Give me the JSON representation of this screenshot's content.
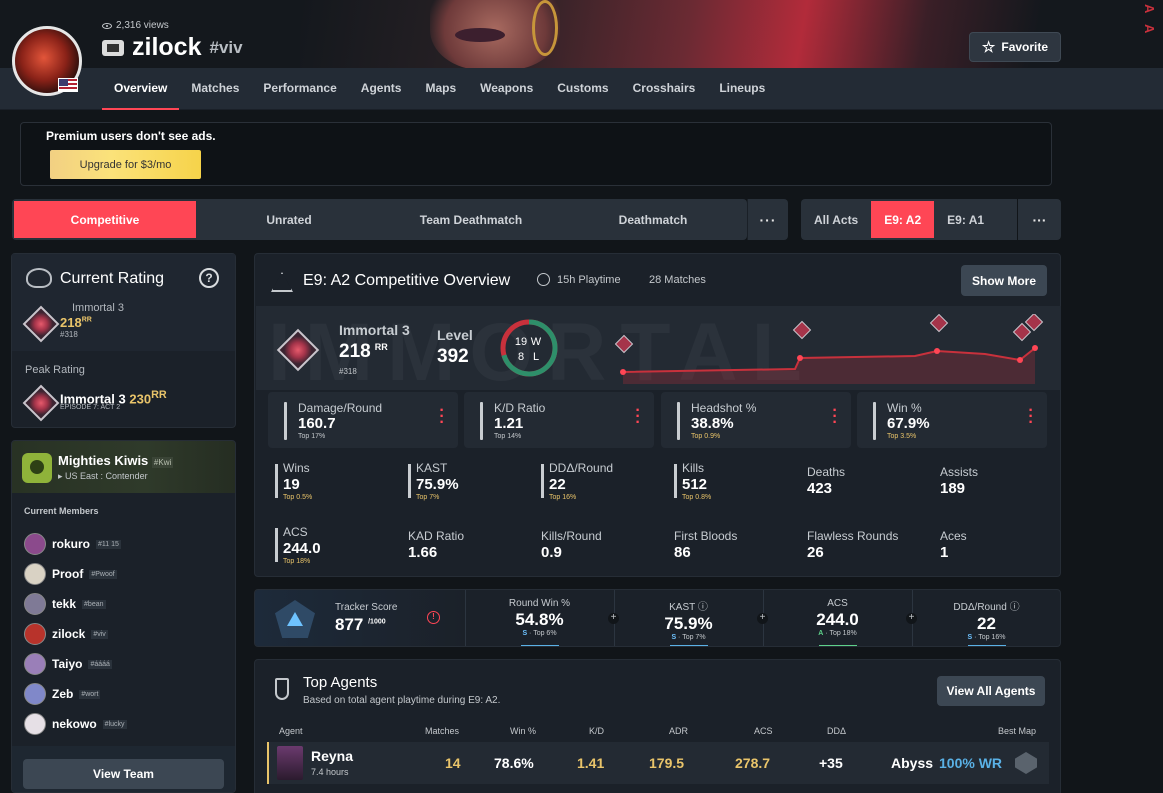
{
  "profile": {
    "views": "2,316 views",
    "username": "zilock",
    "tagline": "#viv",
    "favorite_label": "Favorite",
    "hero_text": "A A"
  },
  "nav_tabs": [
    "Overview",
    "Matches",
    "Performance",
    "Agents",
    "Maps",
    "Weapons",
    "Customs",
    "Crosshairs",
    "Lineups"
  ],
  "ad": {
    "text": "Premium users don't see ads.",
    "button": "Upgrade for $3/mo"
  },
  "modes": [
    "Competitive",
    "Unrated",
    "Team Deathmatch",
    "Deathmatch"
  ],
  "more_label": "···",
  "acts": [
    "All Acts",
    "E9: A2",
    "E9: A1"
  ],
  "current_rating": {
    "title": "Current Rating",
    "help": "?",
    "rank": "Immortal 3",
    "rr": "218",
    "rr_unit": "RR",
    "position": "#318",
    "peak_label": "Peak Rating",
    "peak_rank": "Immortal 3",
    "peak_rr": "230",
    "peak_episode": "EPISODE 7: ACT 2"
  },
  "team": {
    "name": "Mighties Kiwis",
    "tag": "#Kwi",
    "region": "US East : Contender",
    "members_label": "Current Members",
    "members": [
      {
        "name": "rokuro",
        "tag": "#11 15",
        "color": "#8b4a8c"
      },
      {
        "name": "Proof",
        "tag": "#Pwoof",
        "color": "#d9d2c4"
      },
      {
        "name": "tekk",
        "tag": "#bean",
        "color": "#7f7a96"
      },
      {
        "name": "zilock",
        "tag": "#viv",
        "color": "#b8332b"
      },
      {
        "name": "Taiyo",
        "tag": "#áááá",
        "color": "#9a7fb8"
      },
      {
        "name": "Zeb",
        "tag": "#wort",
        "color": "#8088c9"
      },
      {
        "name": "nekowo",
        "tag": "#lucky",
        "color": "#e6e0e6"
      }
    ],
    "view_team": "View Team"
  },
  "overview": {
    "title": "E9: A2 Competitive Overview",
    "playtime": "15h Playtime",
    "matches": "28 Matches",
    "show_more": "Show More",
    "watermark": "IMMORTAL",
    "rank": "Immortal 3",
    "rr": "218",
    "rr_unit": "RR",
    "position": "#318",
    "level_label": "Level",
    "level": "392",
    "wins": "19",
    "wins_letter": "W",
    "losses": "8",
    "losses_letter": "L",
    "main_stats": [
      {
        "label": "Damage/Round",
        "value": "160.7",
        "top": "Top 17%",
        "highlight": false
      },
      {
        "label": "K/D Ratio",
        "value": "1.21",
        "top": "Top 14%",
        "highlight": false
      },
      {
        "label": "Headshot %",
        "value": "38.8%",
        "top": "Top 0.9%",
        "highlight": true
      },
      {
        "label": "Win %",
        "value": "67.9%",
        "top": "Top 3.5%",
        "highlight": true
      }
    ],
    "stats_row1": [
      {
        "label": "Wins",
        "value": "19",
        "top": "Top 0.5%"
      },
      {
        "label": "KAST",
        "value": "75.9%",
        "top": "Top 7%"
      },
      {
        "label": "DDΔ/Round",
        "value": "22",
        "top": "Top 16%"
      },
      {
        "label": "Kills",
        "value": "512",
        "top": "Top 0.8%"
      },
      {
        "label": "Deaths",
        "value": "423",
        "top": ""
      },
      {
        "label": "Assists",
        "value": "189",
        "top": ""
      }
    ],
    "stats_row2": [
      {
        "label": "ACS",
        "value": "244.0",
        "top": "Top 18%"
      },
      {
        "label": "KAD Ratio",
        "value": "1.66",
        "top": ""
      },
      {
        "label": "Kills/Round",
        "value": "0.9",
        "top": ""
      },
      {
        "label": "First Bloods",
        "value": "86",
        "top": ""
      },
      {
        "label": "Flawless Rounds",
        "value": "26",
        "top": ""
      },
      {
        "label": "Aces",
        "value": "1",
        "top": ""
      }
    ]
  },
  "tracker": {
    "label": "Tracker Score",
    "score": "877",
    "max": "/1000",
    "info": "!",
    "stats": [
      {
        "label": "Round Win %",
        "value": "54.8%",
        "grade": "S",
        "top": " · Top 6%"
      },
      {
        "label": "KAST ⓘ",
        "value": "75.9%",
        "grade": "S",
        "top": " · Top 7%"
      },
      {
        "label": "ACS",
        "value": "244.0",
        "grade": "A",
        "top": " · Top 18%"
      },
      {
        "label": "DDΔ/Round ⓘ",
        "value": "22",
        "grade": "S",
        "top": " · Top 16%"
      }
    ]
  },
  "top_agents": {
    "title": "Top Agents",
    "subtitle": "Based on total agent playtime during E9: A2.",
    "view_all": "View All Agents",
    "headers": [
      "Agent",
      "Matches",
      "Win %",
      "K/D",
      "ADR",
      "ACS",
      "DDΔ",
      "Best Map"
    ],
    "row": {
      "agent": "Reyna",
      "hours": "7.4 hours",
      "matches": "14",
      "win": "78.6%",
      "kd": "1.41",
      "adr": "179.5",
      "acs": "278.7",
      "ddelta": "+35",
      "map": "Abyss",
      "map_wr": "100% WR"
    }
  },
  "colors": {
    "accent": "#ff4655",
    "gold": "#e9c46a",
    "blue": "#5ab1e6",
    "green": "#5ed18a",
    "win_arc": "#2e8f6a",
    "loss_arc": "#c8313c"
  }
}
